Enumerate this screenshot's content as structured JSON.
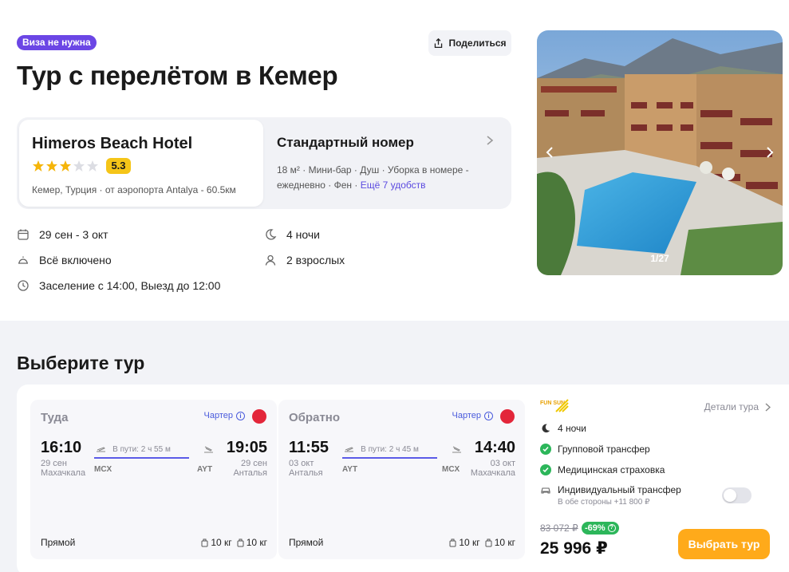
{
  "header": {
    "visa_badge": "Виза не нужна",
    "share_label": "Поделиться",
    "title": "Тур с перелётом в Кемер"
  },
  "hotel": {
    "name": "Himeros Beach Hotel",
    "stars": 3,
    "stars_max": 5,
    "rating": "5.3",
    "location": "Кемер, Турция",
    "airport": "от аэропорта Antalya - 60.5км"
  },
  "room": {
    "title": "Стандартный номер",
    "amenities_line1": "18 м² · Мини-бар · Душ · Уборка в номере -",
    "amenities_line2": "ежедневно · Фен · ",
    "more_link": "Ещё 7 удобств"
  },
  "facts": {
    "dates": "29 сен - 3 окт",
    "nights": "4 ночи",
    "meal": "Всё включено",
    "guests": "2 взрослых",
    "checkin": "Заселение с 14:00, Выезд до 12:00"
  },
  "photo": {
    "counter": "1/27"
  },
  "tours": {
    "title": "Выберите тур",
    "outbound": {
      "heading": "Туда",
      "charter": "Чартер",
      "dep_time": "16:10",
      "arr_time": "19:05",
      "dep_date": "29 сен",
      "arr_date": "29 сен",
      "dep_city": "Махачкала",
      "arr_city": "Анталья",
      "duration": "В пути: 2 ч 55 м",
      "dep_code": "MCX",
      "arr_code": "AYT",
      "direct": "Прямой",
      "bag1": "10 кг",
      "bag2": "10 кг"
    },
    "inbound": {
      "heading": "Обратно",
      "charter": "Чартер",
      "dep_time": "11:55",
      "arr_time": "14:40",
      "dep_date": "03 окт",
      "arr_date": "03 окт",
      "dep_city": "Анталья",
      "arr_city": "Махачкала",
      "duration": "В пути: 2 ч 45 м",
      "dep_code": "AYT",
      "arr_code": "MCX",
      "direct": "Прямой",
      "bag1": "10 кг",
      "bag2": "10 кг"
    },
    "side": {
      "operator_logo_text": "FUN SUN",
      "details_link": "Детали тура",
      "nights": "4 ночи",
      "transfer": "Групповой трансфер",
      "insurance": "Медицинская страховка",
      "individual_transfer": "Индивидуальный трансфер",
      "individual_transfer_sub": "В обе стороны +11 800 ₽",
      "toggle_on": false,
      "old_price": "83 072 ₽",
      "discount": "-69%",
      "price": "25 996 ₽",
      "select_button": "Выбрать тур"
    }
  },
  "colors": {
    "accent_purple": "#6b46e5",
    "link": "#5b4ae0",
    "button_orange": "#ffaa1a",
    "rating_yellow": "#f5c518",
    "check_green": "#2cb65a"
  }
}
